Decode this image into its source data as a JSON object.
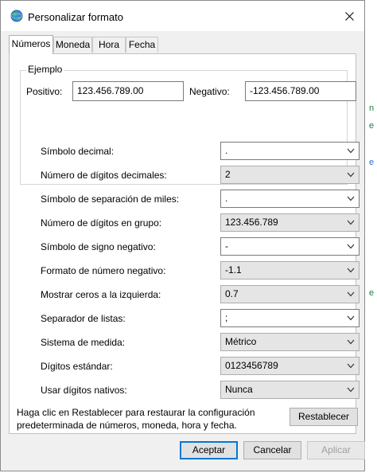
{
  "dialog": {
    "title": "Personalizar formato",
    "close_icon": "close-icon"
  },
  "tabs": [
    {
      "label": "Números",
      "active": true
    },
    {
      "label": "Moneda",
      "active": false
    },
    {
      "label": "Hora",
      "active": false
    },
    {
      "label": "Fecha",
      "active": false
    }
  ],
  "example": {
    "group_title": "Ejemplo",
    "positive_label": "Positivo:",
    "positive_value": "123.456.789.00",
    "negative_label": "Negativo:",
    "negative_value": "-123.456.789.00"
  },
  "settings": [
    {
      "label": "Símbolo decimal:",
      "value": ".",
      "kind": "editable"
    },
    {
      "label": "Número de dígitos decimales:",
      "value": "2",
      "kind": "dropdown"
    },
    {
      "label": "Símbolo de separación de miles:",
      "value": ".",
      "kind": "editable"
    },
    {
      "label": "Número de dígitos en grupo:",
      "value": "123.456.789",
      "kind": "dropdown"
    },
    {
      "label": "Símbolo de signo negativo:",
      "value": "-",
      "kind": "editable"
    },
    {
      "label": "Formato de número negativo:",
      "value": "-1.1",
      "kind": "dropdown"
    },
    {
      "label": "Mostrar ceros a la izquierda:",
      "value": "0.7",
      "kind": "dropdown"
    },
    {
      "label": "Separador de listas:",
      "value": ";",
      "kind": "editable"
    },
    {
      "label": "Sistema de medida:",
      "value": "Métrico",
      "kind": "dropdown"
    },
    {
      "label": "Dígitos estándar:",
      "value": "0123456789",
      "kind": "dropdown"
    },
    {
      "label": "Usar dígitos nativos:",
      "value": "Nunca",
      "kind": "dropdown"
    }
  ],
  "help": {
    "line1": "Haga clic en Restablecer para restaurar la configuración",
    "line2": "predeterminada de números, moneda, hora y fecha."
  },
  "buttons": {
    "reset": "Restablecer",
    "accept": "Aceptar",
    "cancel": "Cancelar",
    "apply": "Aplicar"
  },
  "background_marks": [
    "n",
    "e",
    "e",
    "e"
  ]
}
